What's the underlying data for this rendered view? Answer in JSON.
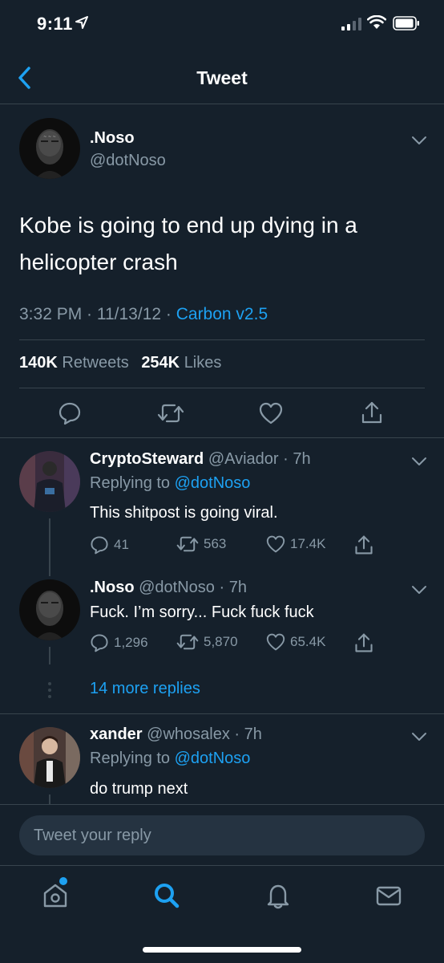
{
  "status_bar": {
    "time": "9:11"
  },
  "header": {
    "title": "Tweet"
  },
  "main_tweet": {
    "name": ".Noso",
    "handle": "@dotNoso",
    "text": "Kobe is going to end up dying in a helicopter crash",
    "time": "3:32 PM · 11/13/12 · ",
    "source": "Carbon v2.5",
    "retweets_count": "140K",
    "retweets_label": "Retweets",
    "likes_count": "254K",
    "likes_label": "Likes"
  },
  "replies": [
    {
      "name": "CryptoSteward",
      "handle": "@Aviador",
      "age": " · 7h",
      "replying_prefix": "Replying to ",
      "replying_to": "@dotNoso",
      "text": "This shitpost is going viral.",
      "replies": "41",
      "retweets": "563",
      "likes": "17.4K"
    },
    {
      "name": ".Noso",
      "handle": "@dotNoso",
      "age": " · 7h",
      "text": "Fuck. I’m sorry... Fuck fuck fuck",
      "replies": "1,296",
      "retweets": "5,870",
      "likes": "65.4K"
    },
    {
      "name": "xander",
      "handle": "@whosalex",
      "age": " · 7h",
      "replying_prefix": "Replying to ",
      "replying_to": "@dotNoso",
      "text": "do trump next"
    }
  ],
  "more_replies": "14 more replies",
  "composer": {
    "placeholder": "Tweet your reply"
  },
  "colors": {
    "background": "#15202b",
    "accent": "#1da1f2",
    "secondary_text": "#8899a6",
    "divider": "#38444d"
  },
  "tabs": [
    {
      "icon": "home-icon",
      "active": false,
      "notification_dot": true
    },
    {
      "icon": "search-icon",
      "active": true
    },
    {
      "icon": "notifications-icon",
      "active": false
    },
    {
      "icon": "messages-icon",
      "active": false
    }
  ]
}
